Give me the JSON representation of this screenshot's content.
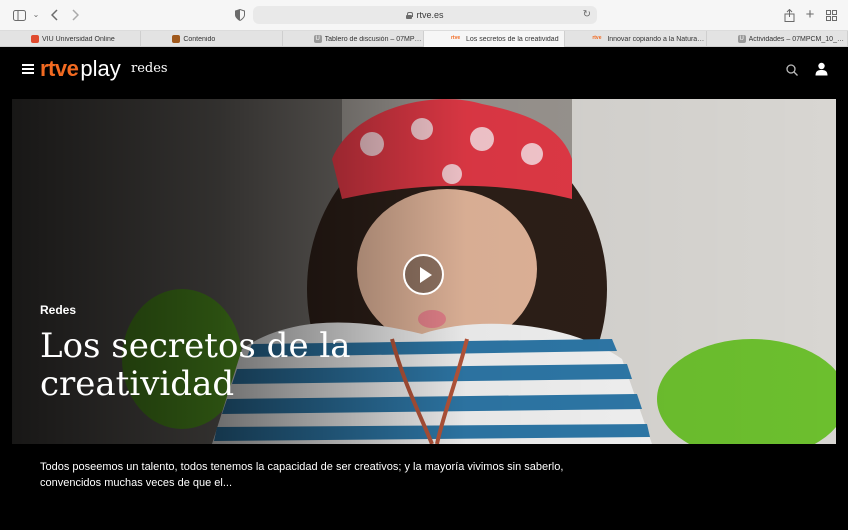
{
  "browser": {
    "url": "rtve.es",
    "tabs": [
      {
        "title": "VIU Universidad Online",
        "favicon": "viu-favicon"
      },
      {
        "title": "Contenido",
        "favicon": "contenido-favicon"
      },
      {
        "title": "Tablero de discusión – 07MPC...",
        "favicon": "u-favicon"
      },
      {
        "title": "Los secretos de la creatividad",
        "favicon": "rtve-favicon",
        "active": true
      },
      {
        "title": "Innovar copiando a la Naturaleza",
        "favicon": "rtve-favicon"
      },
      {
        "title": "Actividades – 07MPCM_10_A_2...",
        "favicon": "u-favicon"
      }
    ],
    "fav_u_letter": "U",
    "fav_rtve_text": "rtve"
  },
  "site": {
    "logo_brand": "rtve",
    "logo_product": "play",
    "section": "redes"
  },
  "hero": {
    "kicker": "Redes",
    "title": "Los secretos de la creatividad"
  },
  "description": "Todos poseemos un talento, todos tenemos la capacidad de ser creativos; y la mayoría vivimos sin saberlo, convencidos muchas veces de que el...",
  "colors": {
    "brand_orange": "#f26a21",
    "background": "#000000"
  }
}
